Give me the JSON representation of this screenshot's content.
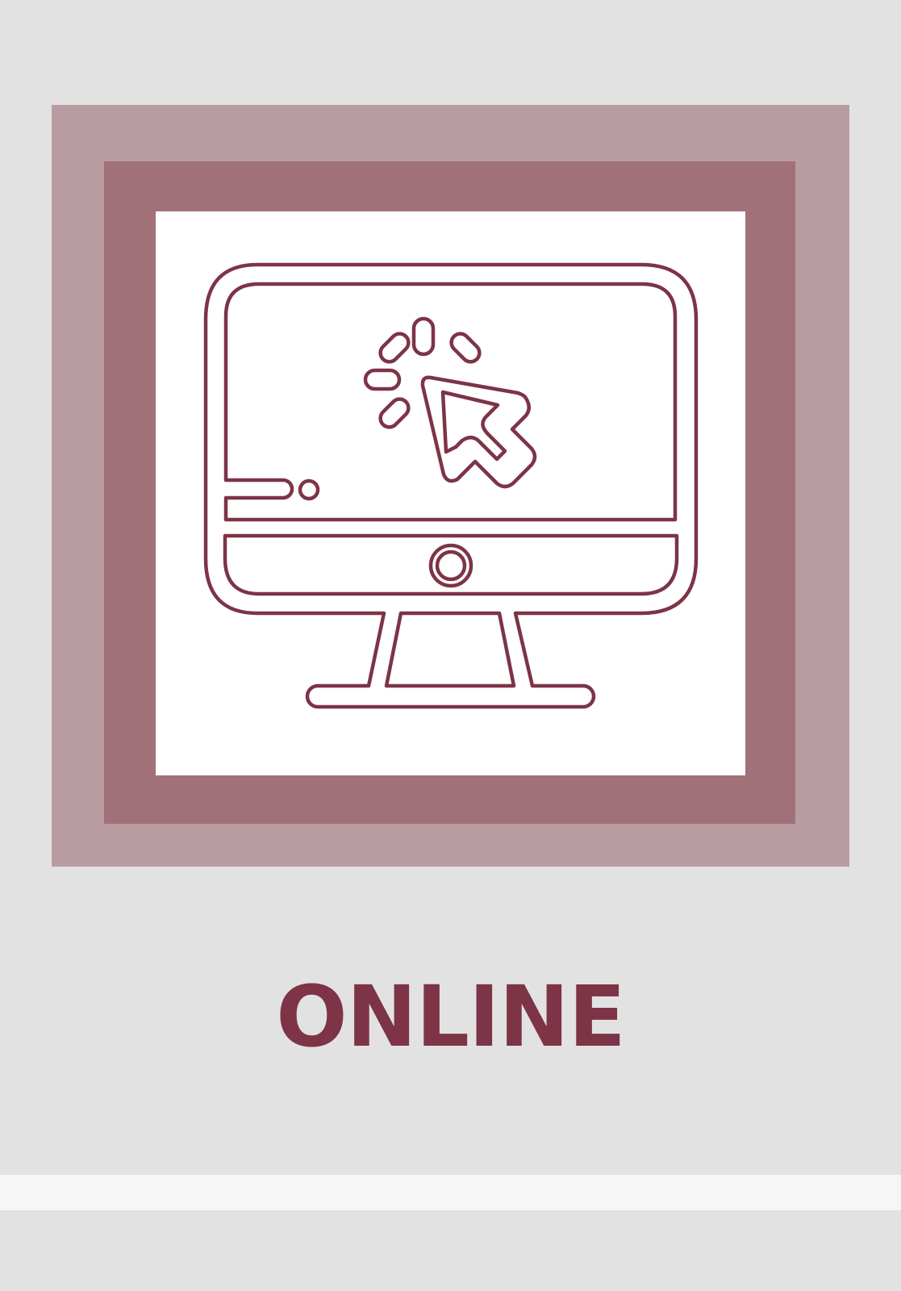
{
  "card": {
    "label": "ONLINE",
    "icon": "computer-click-icon"
  },
  "colors": {
    "background": "#e2e2e2",
    "frame_outer": "#b89ca1",
    "frame_mid": "#a07179",
    "frame_inner": "#ffffff",
    "icon_stroke": "#7d3446",
    "label_text": "#7d3446",
    "band": "#f6f6f6"
  }
}
